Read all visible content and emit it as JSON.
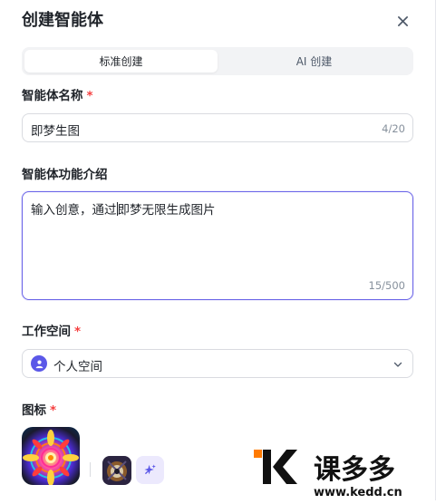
{
  "dialog": {
    "title": "创建智能体",
    "close_icon": "close-icon"
  },
  "mode_tabs": [
    {
      "label": "标准创建",
      "active": true
    },
    {
      "label": "AI 创建",
      "active": false
    }
  ],
  "name_field": {
    "label": "智能体名称",
    "required_mark": "*",
    "value": "即梦生图",
    "count": "4/20"
  },
  "description_field": {
    "label": "智能体功能介绍",
    "value_before_caret": "输入创意，通过",
    "value_after_caret": "即梦无限生成图片",
    "count": "15/500"
  },
  "workspace_field": {
    "label": "工作空间",
    "required_mark": "*",
    "value": "个人空间",
    "icon": "user-avatar-icon"
  },
  "icon_field": {
    "label": "图标",
    "required_mark": "*",
    "ai_generate_icon": "sparkle-icon"
  },
  "watermark": {
    "logo_text": "课多多",
    "url": "www.kedd.cn"
  },
  "colors": {
    "accent": "#5b58e8",
    "required": "#f53f3f",
    "focus_border": "#6b65e8"
  }
}
